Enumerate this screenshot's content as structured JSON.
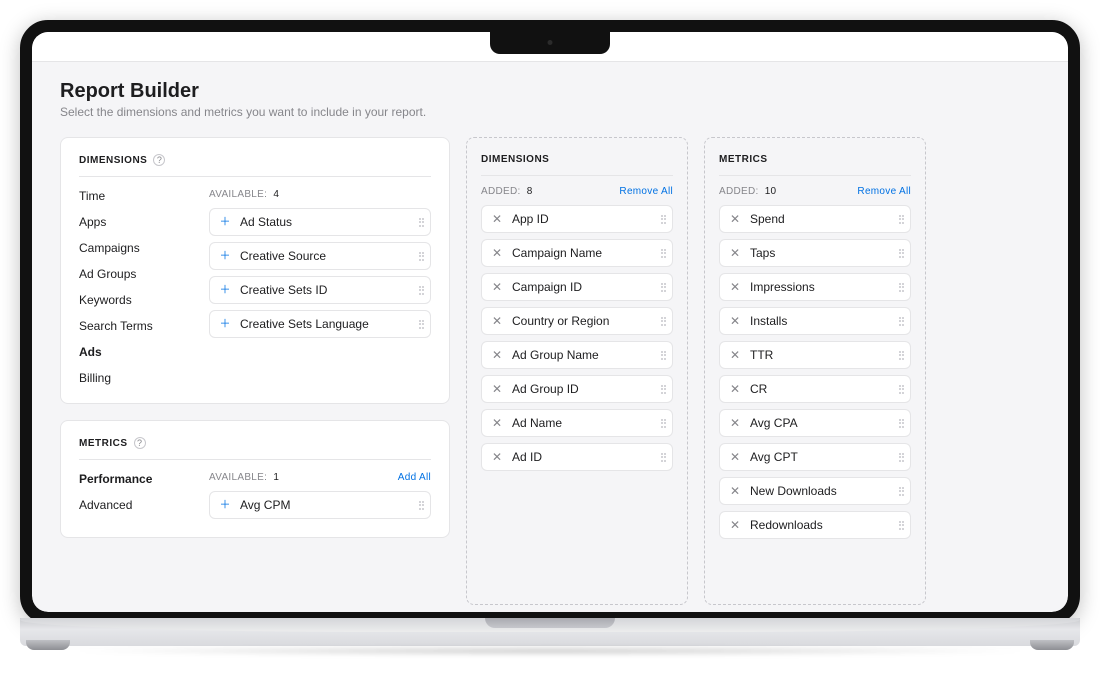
{
  "header": {
    "title": "Report Builder",
    "subtitle": "Select the dimensions and metrics you want to include in your report."
  },
  "available_dimensions": {
    "section_label": "DIMENSIONS",
    "categories": [
      "Time",
      "Apps",
      "Campaigns",
      "Ad Groups",
      "Keywords",
      "Search Terms",
      "Ads",
      "Billing"
    ],
    "active_category": "Ads",
    "available_label": "AVAILABLE:",
    "available_count": "4",
    "items": [
      "Ad Status",
      "Creative Source",
      "Creative Sets ID",
      "Creative Sets Language"
    ]
  },
  "available_metrics": {
    "section_label": "METRICS",
    "categories": [
      "Performance",
      "Advanced"
    ],
    "active_category": "Performance",
    "available_label": "AVAILABLE:",
    "available_count": "1",
    "add_all_label": "Add All",
    "items": [
      "Avg CPM"
    ]
  },
  "added_dimensions": {
    "section_label": "DIMENSIONS",
    "added_label": "ADDED:",
    "added_count": "8",
    "remove_all_label": "Remove All",
    "items": [
      "App ID",
      "Campaign Name",
      "Campaign ID",
      "Country or Region",
      "Ad Group Name",
      "Ad Group ID",
      "Ad Name",
      "Ad ID"
    ]
  },
  "added_metrics": {
    "section_label": "METRICS",
    "added_label": "ADDED:",
    "added_count": "10",
    "remove_all_label": "Remove All",
    "items": [
      "Spend",
      "Taps",
      "Impressions",
      "Installs",
      "TTR",
      "CR",
      "Avg CPA",
      "Avg CPT",
      "New Downloads",
      "Redownloads"
    ]
  }
}
